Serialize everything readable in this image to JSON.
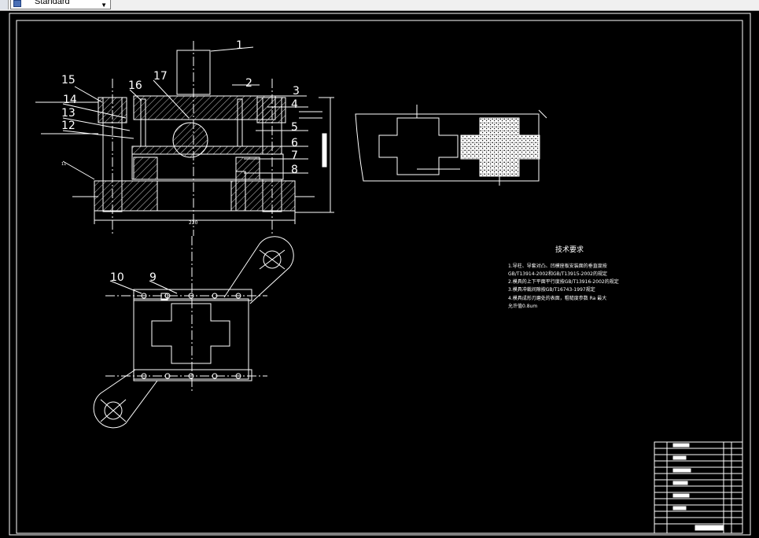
{
  "toolbar": {
    "style_value": "Standard",
    "dropdown_arrow": "chevron-down-icon"
  },
  "drawing": {
    "balloons": [
      "1",
      "2",
      "3",
      "4",
      "5",
      "6",
      "7",
      "8",
      "9",
      "10",
      "11",
      "12",
      "13",
      "14",
      "15",
      "16",
      "17"
    ],
    "dimension_text": "220",
    "tech_title": "技术要求",
    "tech_lines": [
      "1.导柱、导套对凸、凹模座板安装面的垂直度按",
      "GB/T13914-2002和GB/T13915-2002的规定",
      "2.模具的上下平面平行度按GB/T13916-2002的规定",
      "3.模具冲裁间隙按GB/T16743-1997规定",
      "4.模具成形刃磨处的表面，粗糙度参数 Ra 最大",
      "允许值0.8um"
    ]
  },
  "colors": {
    "background": "#000000",
    "line": "#ffffff",
    "hatch": "#d0d0d0"
  }
}
